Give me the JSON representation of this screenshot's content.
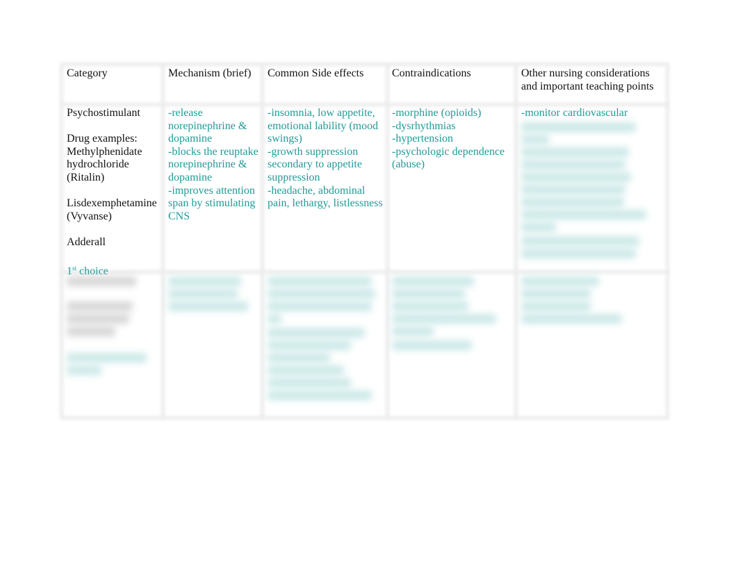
{
  "table": {
    "headers": [
      "Category",
      "Mechanism (brief)",
      "Common Side effects",
      "Contraindications",
      "Other nursing considerations and important teaching points"
    ],
    "row1": {
      "category": "Psychostimulant",
      "drug_examples_label": "Drug examples:",
      "drug1": "Methylphenidate hydrochloride (Ritalin)",
      "drug2": "Lisdexemphetamine (Vyvanse)",
      "drug3": "Adderall",
      "choice_number": "1",
      "choice_sup": "st",
      "choice_text": " choice",
      "mechanism": [
        "-release norepinephrine & dopamine",
        "-blocks the reuptake norepinephrine & dopamine",
        "-improves attention span by stimulating CNS"
      ],
      "side_effects": [
        "-insomnia, low appetite, emotional lability (mood swings)",
        "-growth suppression secondary to appetite suppression",
        "-headache, abdominal pain, lethargy, listlessness"
      ],
      "contraindications": [
        "-morphine (opioids)",
        "-dysrhythmias",
        "-hypertension",
        "-psychologic dependence (abuse)"
      ],
      "nursing": [
        "-monitor cardiovascular"
      ]
    },
    "colors": {
      "teal_text": "#1f9a97",
      "black_text": "#111111",
      "grid": "#ececec"
    }
  }
}
